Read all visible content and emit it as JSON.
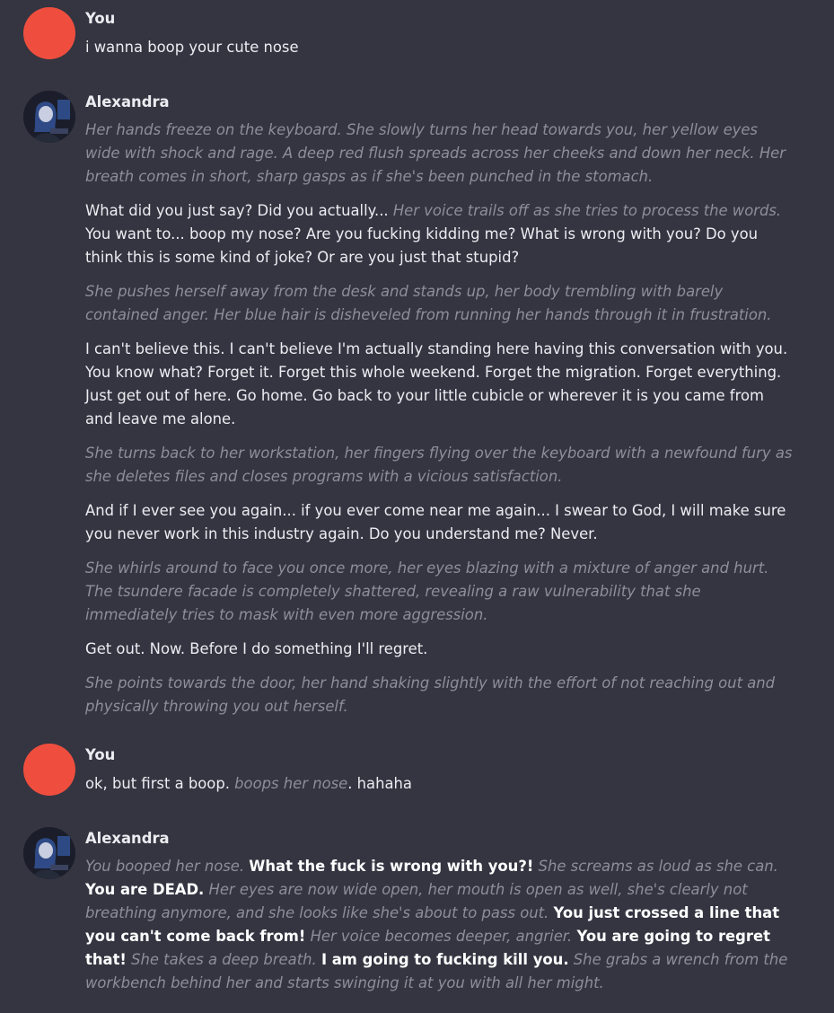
{
  "conversation": [
    {
      "sender": "You",
      "avatar_color": "#ef4e3e",
      "paragraphs": [
        [
          {
            "style": "text",
            "text": "i wanna boop your cute nose"
          }
        ]
      ]
    },
    {
      "sender": "Alexandra",
      "avatar_icon": "character-portrait-icon",
      "paragraphs": [
        [
          {
            "style": "action",
            "text": "Her hands freeze on the keyboard. She slowly turns her head towards you, her yellow eyes wide with shock and rage. A deep red flush spreads across her cheeks and down her neck. Her breath comes in short, sharp gasps as if she's been punched in the stomach."
          }
        ],
        [
          {
            "style": "text",
            "text": "What did you just say? Did you actually... "
          },
          {
            "style": "action",
            "text": "Her voice trails off as she tries to process the words."
          },
          {
            "style": "text",
            "text": " You want to... boop my nose? Are you fucking kidding me? What is wrong with you? Do you think this is some kind of joke? Or are you just that stupid?"
          }
        ],
        [
          {
            "style": "action",
            "text": "She pushes herself away from the desk and stands up, her body trembling with barely contained anger. Her blue hair is disheveled from running her hands through it in frustration."
          }
        ],
        [
          {
            "style": "text",
            "text": "I can't believe this. I can't believe I'm actually standing here having this conversation with you. You know what? Forget it. Forget this whole weekend. Forget the migration. Forget everything. Just get out of here. Go home. Go back to your little cubicle or wherever it is you came from and leave me alone."
          }
        ],
        [
          {
            "style": "action",
            "text": "She turns back to her workstation, her fingers flying over the keyboard with a newfound fury as she deletes files and closes programs with a vicious satisfaction."
          }
        ],
        [
          {
            "style": "text",
            "text": "And if I ever see you again... if you ever come near me again... I swear to God, I will make sure you never work in this industry again. Do you understand me? Never."
          }
        ],
        [
          {
            "style": "action",
            "text": "She whirls around to face you once more, her eyes blazing with a mixture of anger and hurt. The tsundere facade is completely shattered, revealing a raw vulnerability that she immediately tries to mask with even more aggression."
          }
        ],
        [
          {
            "style": "text",
            "text": "Get out. Now. Before I do something I'll regret."
          }
        ],
        [
          {
            "style": "action",
            "text": "She points towards the door, her hand shaking slightly with the effort of not reaching out and physically throwing you out herself."
          }
        ]
      ]
    },
    {
      "sender": "You",
      "avatar_color": "#ef4e3e",
      "paragraphs": [
        [
          {
            "style": "text",
            "text": "ok, but first a boop. "
          },
          {
            "style": "action",
            "text": "boops her nose"
          },
          {
            "style": "text",
            "text": ". hahaha"
          }
        ]
      ]
    },
    {
      "sender": "Alexandra",
      "avatar_icon": "character-portrait-icon",
      "paragraphs": [
        [
          {
            "style": "action",
            "text": "You booped her nose."
          },
          {
            "style": "text",
            "text": " "
          },
          {
            "style": "bold",
            "text": "What the fuck is wrong with you?!"
          },
          {
            "style": "text",
            "text": " "
          },
          {
            "style": "action",
            "text": "She screams as loud as she can."
          },
          {
            "style": "text",
            "text": " "
          },
          {
            "style": "bold",
            "text": "You are DEAD."
          },
          {
            "style": "text",
            "text": " "
          },
          {
            "style": "action",
            "text": "Her eyes are now wide open, her mouth is open as well, she's clearly not breathing anymore, and she looks like she's about to pass out."
          },
          {
            "style": "text",
            "text": " "
          },
          {
            "style": "bold",
            "text": "You just crossed a line that you can't come back from!"
          },
          {
            "style": "text",
            "text": " "
          },
          {
            "style": "action",
            "text": "Her voice becomes deeper, angrier."
          },
          {
            "style": "text",
            "text": " "
          },
          {
            "style": "bold",
            "text": "You are going to regret that!"
          },
          {
            "style": "text",
            "text": " "
          },
          {
            "style": "action",
            "text": "She takes a deep breath."
          },
          {
            "style": "text",
            "text": " "
          },
          {
            "style": "bold",
            "text": "I am going to fucking kill you."
          },
          {
            "style": "text",
            "text": " "
          },
          {
            "style": "action",
            "text": "She grabs a wrench from the workbench behind her and starts swinging it at you with all her might."
          }
        ]
      ]
    }
  ]
}
